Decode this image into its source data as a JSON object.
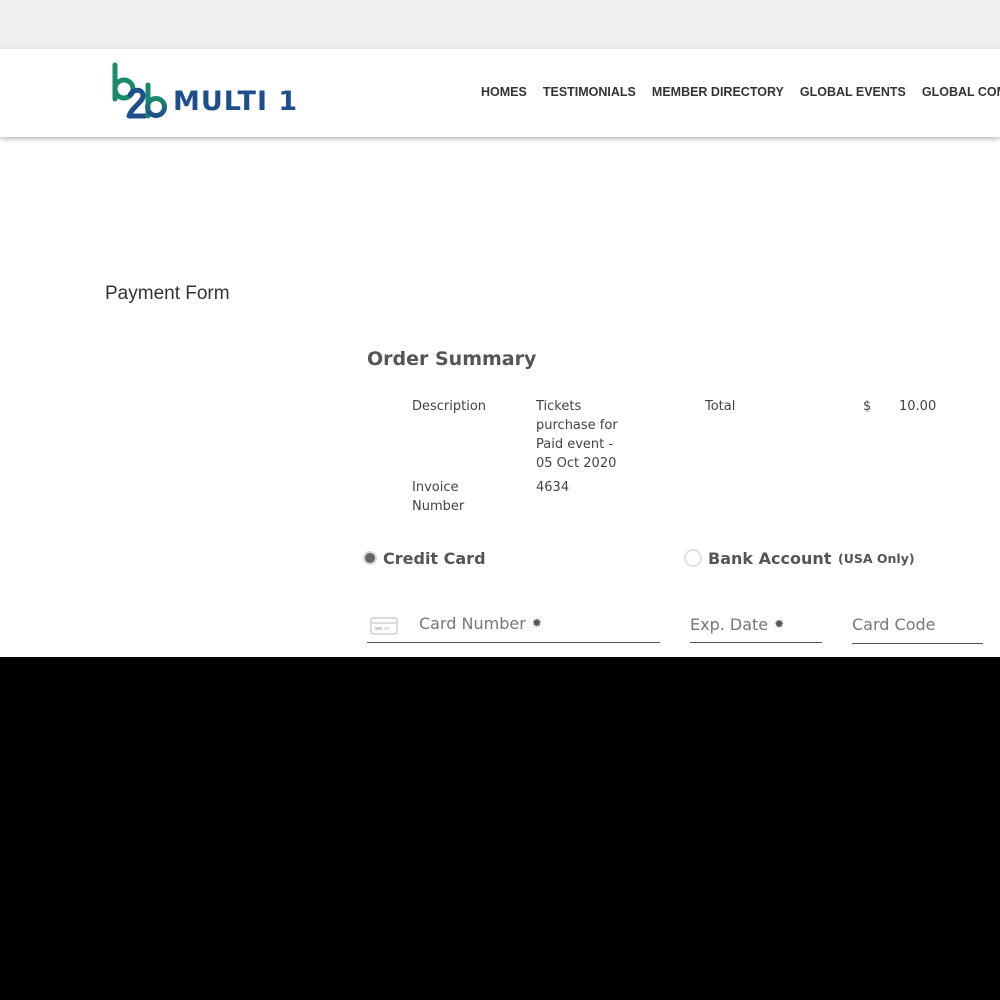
{
  "header": {
    "logo_text": "MULTI 1",
    "logo_mark": "b2b",
    "nav": [
      "HOMES",
      "TESTIMONIALS",
      "MEMBER DIRECTORY",
      "GLOBAL EVENTS",
      "GLOBAL COMM"
    ]
  },
  "page": {
    "title": "Payment Form"
  },
  "order_summary": {
    "title": "Order Summary",
    "description_label": "Description",
    "description_lines": [
      "Tickets",
      "purchase for",
      "Paid event -",
      "05 Oct 2020"
    ],
    "total_label": "Total",
    "currency": "$",
    "total_value": "10.00",
    "invoice_label_lines": [
      "Invoice",
      "Number"
    ],
    "invoice_value": "4634"
  },
  "payment_method": {
    "selected": "Credit Card",
    "options": [
      "Credit Card",
      "Bank Account"
    ],
    "bank_note": "(USA Only)"
  },
  "fields": {
    "card_number": "Card Number",
    "exp_date": "Exp. Date",
    "card_code": "Card Code",
    "required_mark": "✹"
  },
  "colors": {
    "logo_blue": "#1c4f8c",
    "logo_green": "#1a8a6c",
    "text": "#333333",
    "muted": "#555555"
  },
  "icons": {
    "card": "credit-card-icon",
    "required": "asterisk-icon"
  }
}
